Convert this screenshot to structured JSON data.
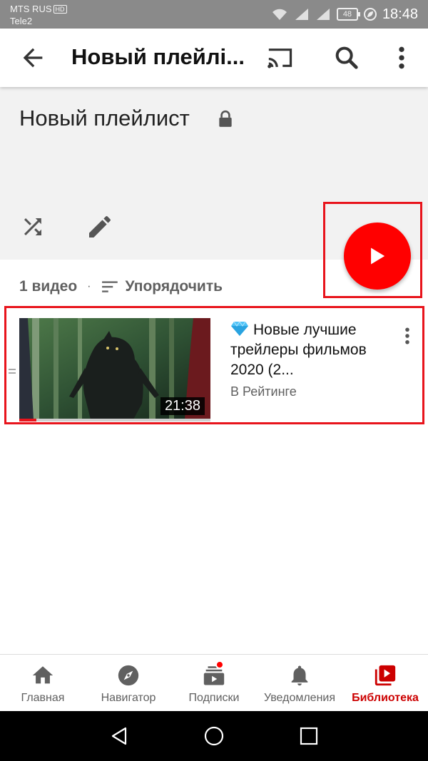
{
  "status_bar": {
    "carrier_primary": "MTS RUS",
    "hd_badge": "HD",
    "carrier_secondary": "Tele2",
    "battery": "48",
    "time": "18:48"
  },
  "app_bar": {
    "title": "Новый плейлі..."
  },
  "playlist": {
    "title": "Новый плейлист",
    "video_count": "1 видео",
    "separator": "·",
    "sort_label": "Упорядочить"
  },
  "video": {
    "title_emoji": "💎",
    "title": "Новые лучшие трейлеры фильмов 2020 (2...",
    "channel": "В Рейтинге",
    "duration": "21:38",
    "watched_fraction": 0.09
  },
  "bottom_nav": {
    "items": [
      {
        "label": "Главная",
        "icon": "home-icon"
      },
      {
        "label": "Навигатор",
        "icon": "explore-icon"
      },
      {
        "label": "Подписки",
        "icon": "subscriptions-icon"
      },
      {
        "label": "Уведомления",
        "icon": "bell-icon"
      },
      {
        "label": "Библиотека",
        "icon": "library-icon"
      }
    ]
  },
  "colors": {
    "accent_red": "#ff0000",
    "highlight_border": "#e8141c",
    "active_nav": "#cc0000",
    "header_bg": "#f2f2f2"
  }
}
